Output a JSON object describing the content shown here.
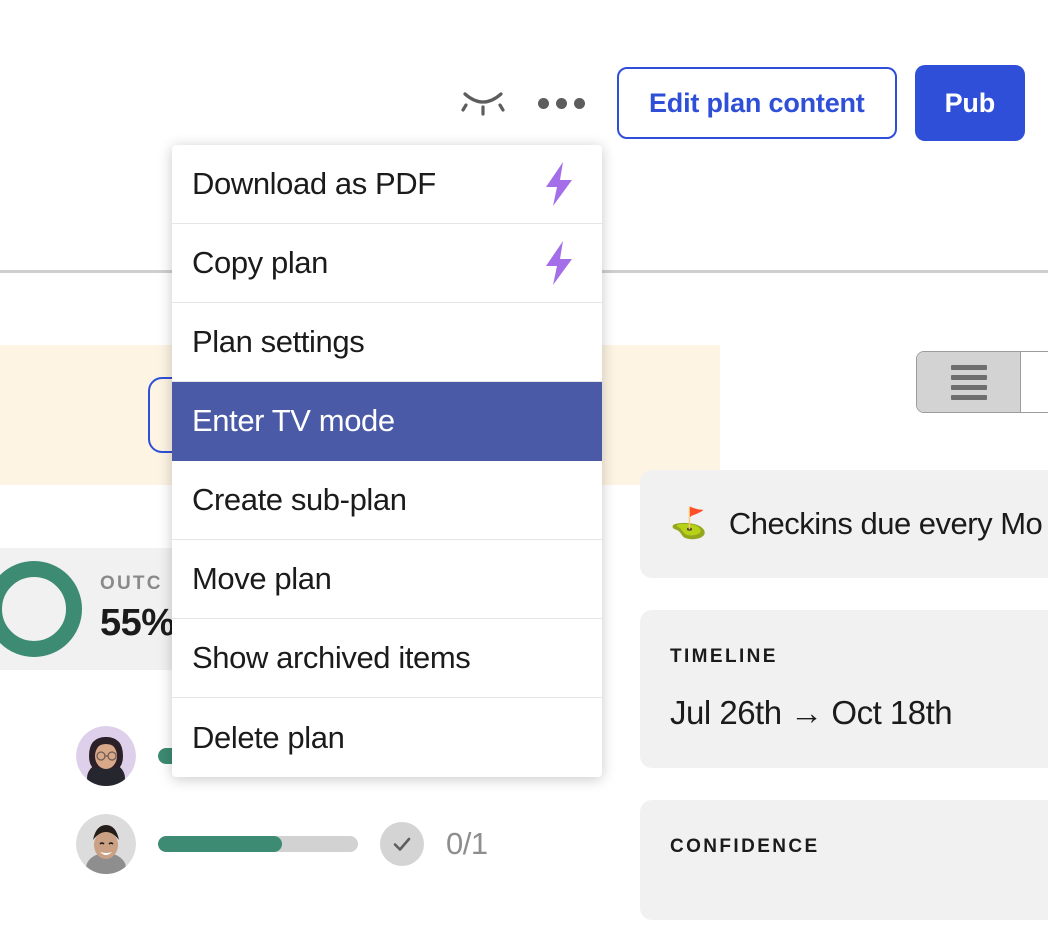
{
  "toolbar": {
    "hide_icon": "eye-off-icon",
    "more_icon": "ellipsis-icon",
    "edit_label": "Edit plan content",
    "publish_label": "Pub"
  },
  "menu": {
    "items": [
      {
        "label": "Download as PDF",
        "icon": "lightning-bolt-icon",
        "has_icon": true,
        "highlighted": false
      },
      {
        "label": "Copy plan",
        "icon": "lightning-bolt-icon",
        "has_icon": true,
        "highlighted": false
      },
      {
        "label": "Plan settings",
        "has_icon": false,
        "highlighted": false
      },
      {
        "label": "Enter TV mode",
        "has_icon": false,
        "highlighted": true
      },
      {
        "label": "Create sub-plan",
        "has_icon": false,
        "highlighted": false
      },
      {
        "label": "Move plan",
        "has_icon": false,
        "highlighted": false
      },
      {
        "label": "Show archived items",
        "has_icon": false,
        "highlighted": false
      },
      {
        "label": "Delete plan",
        "has_icon": false,
        "highlighted": false
      }
    ]
  },
  "outcome": {
    "label": "OUTC",
    "value": "55%",
    "progress_percent": 55
  },
  "members": [
    {
      "progress_percent": 78,
      "count_label": ""
    },
    {
      "progress_percent": 62,
      "count_label": "0/1"
    }
  ],
  "view_toggle": {
    "list_icon": "list-view-icon",
    "active": "list"
  },
  "rail": {
    "checkins": {
      "emoji": "⛳",
      "text": "Checkins due every Mo"
    },
    "timeline": {
      "label": "TIMELINE",
      "value": "Jul 26th → Oct 18th"
    },
    "confidence": {
      "label": "CONFIDENCE"
    }
  },
  "colors": {
    "primary_blue": "#2f4fd8",
    "menu_highlight": "#4a5aa6",
    "bolt_purple": "#a36ee8",
    "progress_green": "#3d8b72",
    "banner_cream": "#fdf4e3",
    "card_gray": "#f1f1f1"
  }
}
